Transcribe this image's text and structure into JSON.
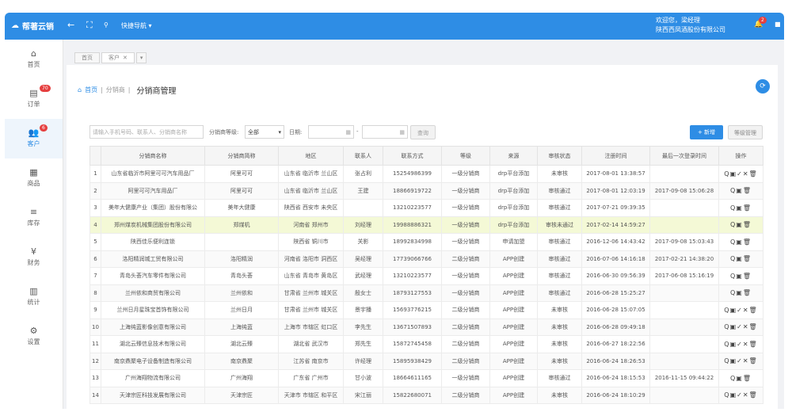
{
  "topbar": {
    "logo_text": "帮著云销",
    "quick_nav": "快捷导航",
    "welcome": "欢迎您，梁经理",
    "company": "陕西西凤酒股份有限公司",
    "bell_count": "2"
  },
  "sidebar": {
    "items": [
      {
        "label": "首页",
        "icon": "⌂",
        "badge": ""
      },
      {
        "label": "订单",
        "icon": "▤",
        "badge": "70"
      },
      {
        "label": "客户",
        "icon": "👥",
        "badge": "6"
      },
      {
        "label": "商品",
        "icon": "▦",
        "badge": ""
      },
      {
        "label": "库存",
        "icon": "≡",
        "badge": ""
      },
      {
        "label": "财务",
        "icon": "¥",
        "badge": ""
      },
      {
        "label": "统计",
        "icon": "▥",
        "badge": ""
      },
      {
        "label": "设置",
        "icon": "⚙",
        "badge": ""
      }
    ]
  },
  "tabs": [
    {
      "label": "首页"
    },
    {
      "label": "客户"
    }
  ],
  "breadcrumb": {
    "home": "首页",
    "level1": "分销商",
    "title": "分销商管理"
  },
  "filter": {
    "search_placeholder": "请输入手机号码、联系人、分销商名称",
    "level_label": "分销商等级:",
    "level_value": "全部",
    "date_label": "日期:",
    "dash": "-",
    "query_label": "查询",
    "add_label": "+ 新增",
    "level_manage_label": "等级管理"
  },
  "table": {
    "headers": [
      "",
      "分销商名称",
      "分销商简称",
      "地区",
      "联系人",
      "联系方式",
      "等级",
      "来源",
      "审核状态",
      "注册时间",
      "最后一次登录时间",
      "操作"
    ],
    "rows": [
      [
        "1",
        "山东省临沂市阿里可可汽车用品厂",
        "阿里可可",
        "山东省 临沂市 兰山区",
        "张占利",
        "15254986399",
        "一级分销商",
        "drp平台添加",
        "未审核",
        "2017-08-01 13:38:57",
        "",
        "Q▣✓✕🗑"
      ],
      [
        "2",
        "阿里可可汽车用品厂",
        "阿里可可",
        "山东省 临沂市 兰山区",
        "王建",
        "18866919722",
        "一级分销商",
        "drp平台添加",
        "审核通过",
        "2017-08-01 12:03:19",
        "2017-09-08 15:06:28",
        "Q▣🗑"
      ],
      [
        "3",
        "美年大健康产业（集团）股份有限公",
        "美年大健康",
        "陕西省 西安市 未央区",
        "",
        "13210223577",
        "一级分销商",
        "drp平台添加",
        "审核通过",
        "2017-07-21 09:39:35",
        "",
        "Q▣🗑"
      ],
      [
        "4",
        "郑州煤炭机械集团股份有限公司",
        "郑煤机",
        "河南省 郑州市",
        "刘经理",
        "19988886321",
        "一级分销商",
        "drp平台添加",
        "审核未通过",
        "2017-02-14 14:59:27",
        "",
        "Q▣🗑"
      ],
      [
        "5",
        "陕西佳乐便利连锁",
        "",
        "陕西省 铜川市",
        "关影",
        "18992834998",
        "一级分销商",
        "申请加盟",
        "审核通过",
        "2016-12-06 14:43:42",
        "2017-09-08 15:03:43",
        "Q▣🗑"
      ],
      [
        "6",
        "洛阳精润城工贸有限公司",
        "洛阳精润",
        "河南省 洛阳市 洞西区",
        "吴经理",
        "17739066766",
        "二级分销商",
        "APP创建",
        "审核通过",
        "2016-07-06 14:16:18",
        "2017-02-21 14:38:20",
        "Q▣🗑"
      ],
      [
        "7",
        "青岛头荟汽车零件有限公司",
        "青岛头荟",
        "山东省 青岛市 黄岛区",
        "武经理",
        "13210223577",
        "一级分销商",
        "APP创建",
        "审核通过",
        "2016-06-30 09:56:39",
        "2017-06-08 15:16:19",
        "Q▣🗑"
      ],
      [
        "8",
        "兰州依和商贸有限公司",
        "兰州依和",
        "甘肃省 兰州市 城关区",
        "殷女士",
        "18793127553",
        "一级分销商",
        "APP创建",
        "审核通过",
        "2016-06-28 15:25:27",
        "",
        "Q▣🗑"
      ],
      [
        "9",
        "兰州日月星珠宝首饰有限公司",
        "兰州日月",
        "甘肃省 兰州市 城关区",
        "景宇播",
        "15693776215",
        "二级分销商",
        "APP创建",
        "未审核",
        "2016-06-28 15:07:05",
        "",
        "Q▣✓✕🗑"
      ],
      [
        "10",
        "上海纯蓝影像创意有限公司",
        "上海纯蓝",
        "上海市 市辖区 虹口区",
        "李先生",
        "13671507893",
        "二级分销商",
        "APP创建",
        "未审核",
        "2016-06-28 09:49:18",
        "",
        "Q▣✓✕🗑"
      ],
      [
        "11",
        "湖北云臻信息技术有限公司",
        "湖北云臻",
        "湖北省 武汉市",
        "郑先生",
        "15872745458",
        "二级分销商",
        "APP创建",
        "未审核",
        "2016-06-27 18:22:56",
        "",
        "Q▣✓✕🗑"
      ],
      [
        "12",
        "南京鼎聚电子设备制造有限公司",
        "南京鼎聚",
        "江苏省 南京市",
        "许经理",
        "15895938429",
        "二级分销商",
        "APP创建",
        "未审核",
        "2016-06-24 18:26:53",
        "",
        "Q▣✓✕🗑"
      ],
      [
        "13",
        "广州海翔物流有限公司",
        "广州海翔",
        "广东省 广州市",
        "甘小波",
        "18664611165",
        "一级分销商",
        "APP创建",
        "审核通过",
        "2016-06-24 18:15:53",
        "2016-11-15 09:44:22",
        "Q▣🗑"
      ],
      [
        "14",
        "天津宗匠科技发展有限公司",
        "天津宗匠",
        "天津市 市辖区 和平区",
        "宋江丽",
        "15822680071",
        "二级分销商",
        "APP创建",
        "未审核",
        "2016-06-24 18:10:29",
        "",
        "Q▣✓✕🗑"
      ]
    ]
  },
  "colors": {
    "accent": "#2e8de5",
    "highlight_row": "#f4f9d6",
    "badge": "#e53f3f"
  }
}
